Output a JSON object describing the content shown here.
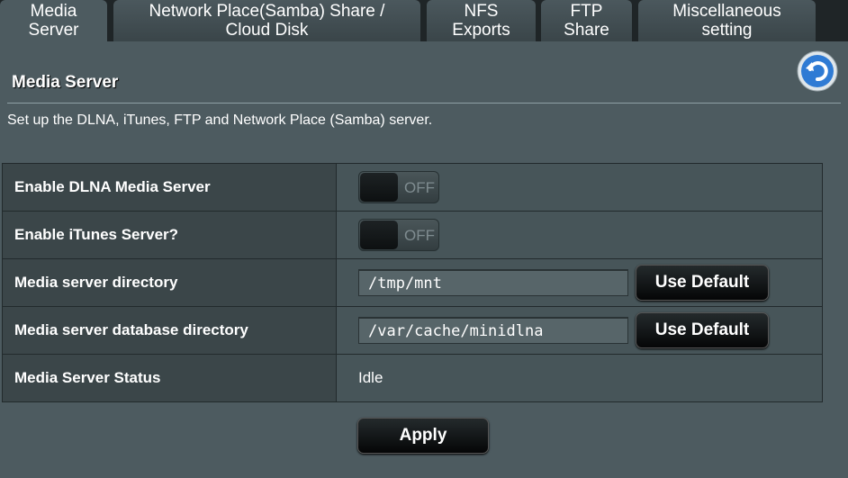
{
  "tabs": [
    {
      "label_line1": "Media",
      "label_line2": "Server"
    },
    {
      "label_line1": "Network Place(Samba) Share /",
      "label_line2": "Cloud Disk"
    },
    {
      "label_line1": "NFS",
      "label_line2": "Exports"
    },
    {
      "label_line1": "FTP",
      "label_line2": "Share"
    },
    {
      "label_line1": "Miscellaneous",
      "label_line2": "setting"
    }
  ],
  "header": {
    "title": "Media Server",
    "description": "Set up the DLNA, iTunes, FTP and Network Place (Samba) server."
  },
  "settings": {
    "dlna": {
      "label": "Enable DLNA Media Server",
      "state": "OFF"
    },
    "itunes": {
      "label": "Enable iTunes Server?",
      "state": "OFF"
    },
    "media_dir": {
      "label": "Media server directory",
      "value": "/tmp/mnt",
      "button": "Use Default"
    },
    "db_dir": {
      "label": "Media server database directory",
      "value": "/var/cache/minidlna",
      "button": "Use Default"
    },
    "status": {
      "label": "Media Server Status",
      "value": "Idle"
    }
  },
  "actions": {
    "apply": "Apply"
  },
  "colors": {
    "panel": "#4d5b60",
    "accent": "#2f7bd4"
  }
}
